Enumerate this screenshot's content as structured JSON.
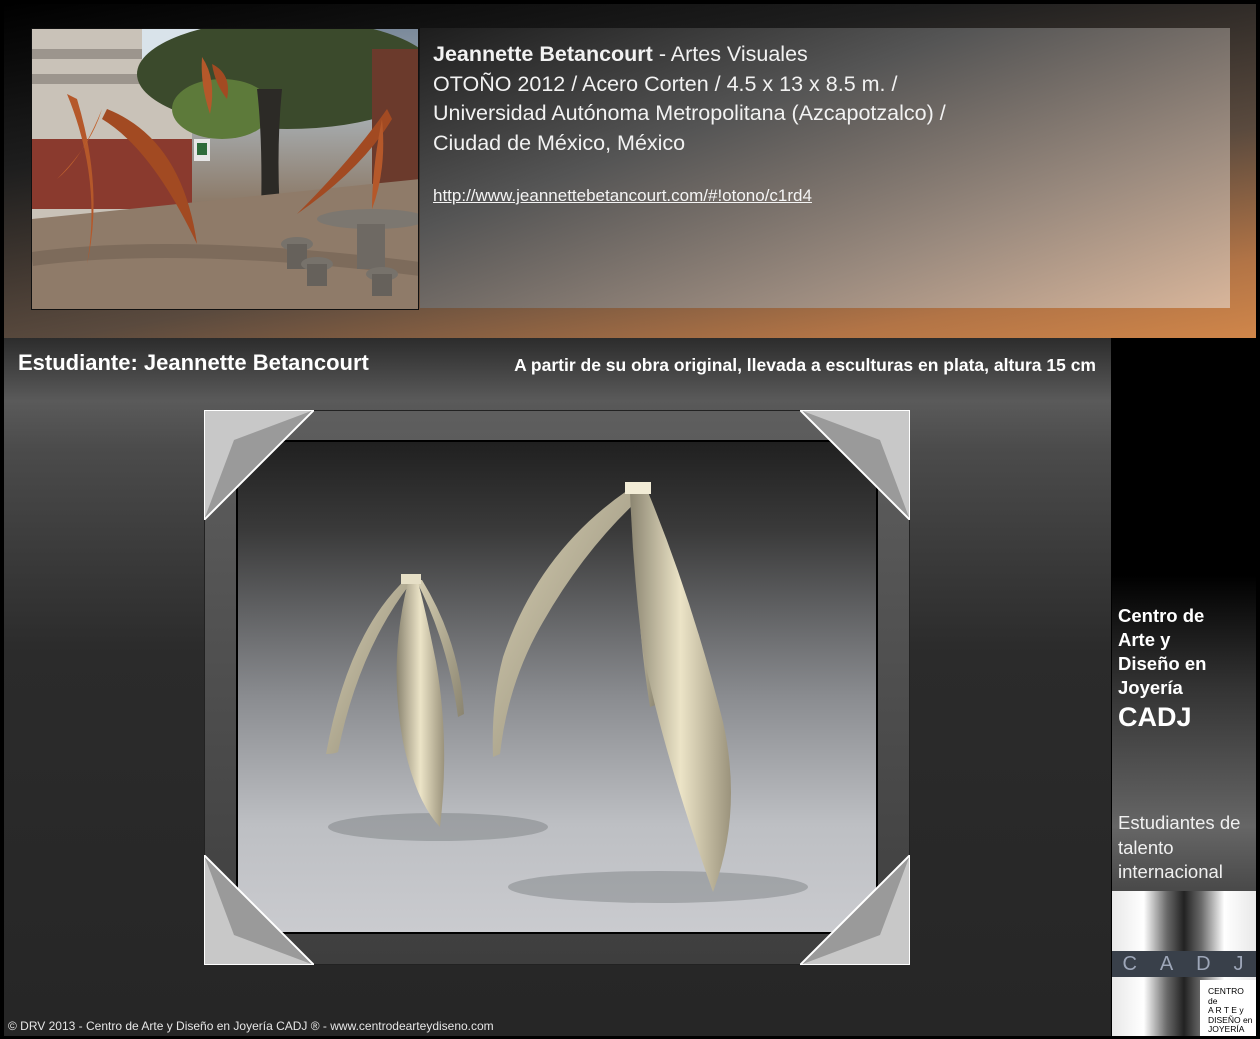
{
  "header": {
    "artist": "Jeannette Betancourt",
    "discipline": " - Artes Visuales",
    "line2": "OTOÑO 2012 / Acero Corten / 4.5 x 13 x 8.5 m. /",
    "line3": "Universidad Autónoma Metropolitana (Azcapotzalco) /",
    "line4": "Ciudad de México, México",
    "link": "http://www.jeannettebetancourt.com/#!otono/c1rd4"
  },
  "main": {
    "student_title": "Estudiante: Jeannette Betancourt",
    "note": "A partir de su obra original, llevada a esculturas en plata, altura 15 cm"
  },
  "sidebar": {
    "name_line1": "Centro de",
    "name_line2": "Arte y",
    "name_line3": "Diseño en",
    "name_line4": "Joyería",
    "acronym": "CADJ",
    "talent_line1": "Estudiantes de",
    "talent_line2": "talento",
    "talent_line3": "internacional"
  },
  "logo": {
    "letters": [
      "C",
      "A",
      "D",
      "J"
    ],
    "block_line1": "CENTRO de",
    "block_line2": "A R T E  y",
    "block_line3": "DISEÑO  en",
    "block_line4": "JOYERÍA"
  },
  "footer": {
    "copyright": "© DRV 2013 - Centro de Arte y Diseño en Joyería CADJ ® - www.centrodearteydiseno.com"
  }
}
